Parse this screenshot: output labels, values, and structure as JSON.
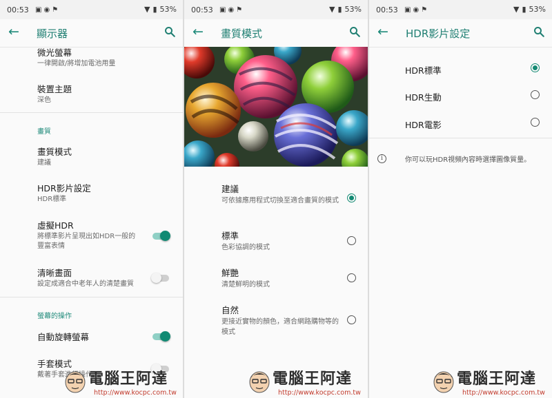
{
  "statusbar": {
    "time": "00:53",
    "battery": "53%"
  },
  "screens": {
    "display": {
      "title": "顯示器",
      "items": [
        {
          "title": "微光螢幕",
          "sub": "一律開啟/將增加電池用量"
        },
        {
          "title": "裝置主題",
          "sub": "深色"
        }
      ],
      "section_quality": "畫質",
      "quality_items": [
        {
          "title": "畫質模式",
          "sub": "建議"
        },
        {
          "title": "HDR影片設定",
          "sub": "HDR標準"
        },
        {
          "title": "虛擬HDR",
          "sub": "將標準影片呈現出如HDR一般的豐富表情",
          "toggle": "on"
        },
        {
          "title": "清晰畫面",
          "sub": "設定成適合中老年人的清楚畫質",
          "toggle": "off"
        }
      ],
      "section_screen": "螢幕的操作",
      "screen_items": [
        {
          "title": "自動旋轉螢幕",
          "toggle": "on"
        },
        {
          "title": "手套模式",
          "sub": "戴著手套進行操作",
          "toggle": "off"
        }
      ]
    },
    "quality": {
      "title": "畫質模式",
      "options": [
        {
          "title": "建議",
          "sub": "可依據應用程式切換至適合畫質的模式",
          "selected": true
        },
        {
          "title": "標準",
          "sub": "色彩協調的模式",
          "selected": false
        },
        {
          "title": "鮮艷",
          "sub": "清楚鮮明的模式",
          "selected": false
        },
        {
          "title": "自然",
          "sub": "更接近實物的顏色，適合網路購物等的模式",
          "selected": false
        }
      ]
    },
    "hdr": {
      "title": "HDR影片設定",
      "options": [
        {
          "label": "HDR標準",
          "selected": true
        },
        {
          "label": "HDR生動",
          "selected": false
        },
        {
          "label": "HDR電影",
          "selected": false
        }
      ],
      "info": "你可以玩HDR視頻內容時選擇圖像質量。"
    }
  },
  "watermark": {
    "title": "電腦王阿達",
    "url": "http://www.kocpc.com.tw"
  },
  "colors": {
    "accent": "#138a73",
    "title": "#1f7f72",
    "background": "#fafafa"
  }
}
